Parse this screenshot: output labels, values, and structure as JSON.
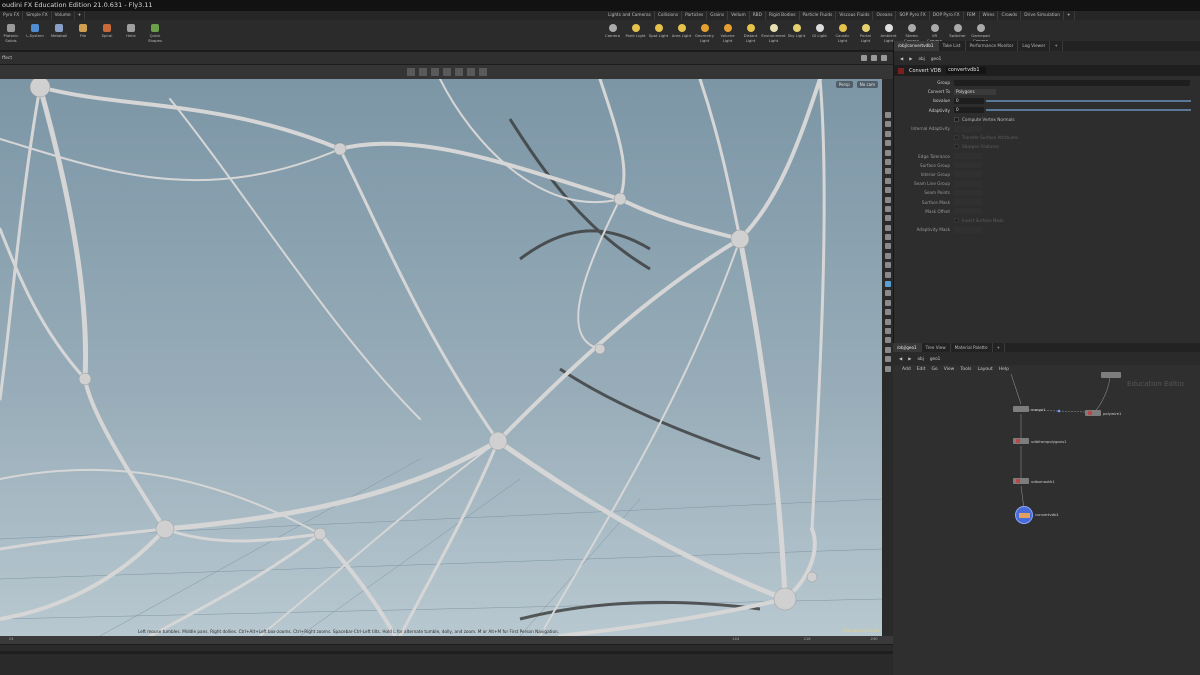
{
  "window": {
    "title": "oudini FX Education Edition 21.0.631 - Fly3.11"
  },
  "shelf": {
    "left_tabs": [
      "Pyro FX",
      "Simple FX",
      "Volume",
      "+"
    ],
    "left_tools": [
      "Platonic Solids",
      "L-System",
      "Metaball",
      "File",
      "Spiral",
      "Helix",
      "Quick Shapes"
    ],
    "right_tabs": [
      "Lights and Cameras",
      "Collisions",
      "Particles",
      "Grains",
      "Vellum",
      "RBD",
      "Rigid Bodies",
      "Particle Fluids",
      "Viscous Fluids",
      "Oceans",
      "SOP Pyro FX",
      "DOP Pyro FX",
      "FEM",
      "Wires",
      "Crowds",
      "Drive Simulation",
      "+"
    ],
    "right_tools": [
      "Camera",
      "Point Light",
      "Spot Light",
      "Area Light",
      "Geometry Light",
      "Volume Light",
      "Distant Light",
      "Environment Light",
      "Sky Light",
      "GI Light",
      "Caustic Light",
      "Portal Light",
      "Ambient Light",
      "Stereo Camera",
      "VR Camera",
      "Switcher",
      "Gamepad Camera"
    ]
  },
  "viewport": {
    "left_label": "ffect",
    "tool_count": 7,
    "persp_label": "Persp",
    "cam_label": "No cam",
    "status": "Left mouse tumbles. Middle pans. Right dollies. Ctrl+Alt+Left box-zooms. Ctrl+Right zooms. Spacebar-Ctrl-Left tilts. Hold L for alternate tumble, dolly, and zoom. M or Alt+M for First Person Navigation.",
    "edu_label": "Education Edition"
  },
  "timeline": {
    "ticks": [
      "24",
      "144",
      "216",
      "240"
    ]
  },
  "right_panel": {
    "tabs": [
      "/obj/convertvdb1",
      "Take List",
      "Performance Monitor",
      "Log Viewer",
      "+"
    ],
    "path": [
      "obj",
      "geo1"
    ],
    "node_type": "Convert VDB",
    "node_name": "convertvdb1",
    "params": [
      {
        "label": "Group",
        "value": "",
        "type": "field",
        "enabled": true
      },
      {
        "label": "Convert To",
        "value": "Polygons",
        "type": "menu",
        "enabled": true
      },
      {
        "label": "Isovalue",
        "value": "0",
        "type": "slider",
        "enabled": true
      },
      {
        "label": "Adaptivity",
        "value": "0",
        "type": "slider",
        "enabled": true
      },
      {
        "label": "",
        "value": "Compute Vertex Normals",
        "type": "check",
        "enabled": true
      },
      {
        "label": "Internal Adaptivity",
        "value": "",
        "type": "field",
        "enabled": false
      },
      {
        "label": "",
        "value": "Transfer Surface Attributes",
        "type": "check",
        "enabled": false
      },
      {
        "label": "",
        "value": "Sharpen Features",
        "type": "check",
        "enabled": false
      },
      {
        "label": "Edge Tolerance",
        "value": "",
        "type": "field",
        "enabled": false
      },
      {
        "label": "Surface Group",
        "value": "",
        "type": "field",
        "enabled": false
      },
      {
        "label": "Interior Group",
        "value": "",
        "type": "field",
        "enabled": false
      },
      {
        "label": "Seam Line Group",
        "value": "",
        "type": "field",
        "enabled": false
      },
      {
        "label": "Seam Points",
        "value": "",
        "type": "field",
        "enabled": false
      },
      {
        "label": "Surface Mask",
        "value": "",
        "type": "field",
        "enabled": false
      },
      {
        "label": "Mask Offset",
        "value": "",
        "type": "field",
        "enabled": false
      },
      {
        "label": "",
        "value": "Invert Surface Mask",
        "type": "check",
        "enabled": false
      },
      {
        "label": "Adaptivity Mask",
        "value": "",
        "type": "field",
        "enabled": false
      }
    ]
  },
  "network": {
    "tabs": [
      "/obj/geo1",
      "Tree View",
      "Material Palette",
      "+"
    ],
    "path": [
      "obj",
      "geo1"
    ],
    "menu": [
      "Add",
      "Edit",
      "Go",
      "View",
      "Tools",
      "Layout",
      "Help"
    ],
    "watermark": "Education Editio",
    "nodes": [
      {
        "name": "merge1",
        "kind": "plain"
      },
      {
        "name": "polywire1",
        "kind": "red"
      },
      {
        "name": "vdbfrompolygons1",
        "kind": "red"
      },
      {
        "name": "vdbsmooth1",
        "kind": "red"
      },
      {
        "name": "convertvdb1",
        "kind": "active"
      }
    ]
  },
  "colors": {
    "ui_dark": "#2d2d2d",
    "viewport_top": "#7c96a6",
    "viewport_bottom": "#b8c8d0",
    "wire": "#d8d8d8",
    "slider": "#5a7896",
    "node_highlight": "#5577dd"
  }
}
